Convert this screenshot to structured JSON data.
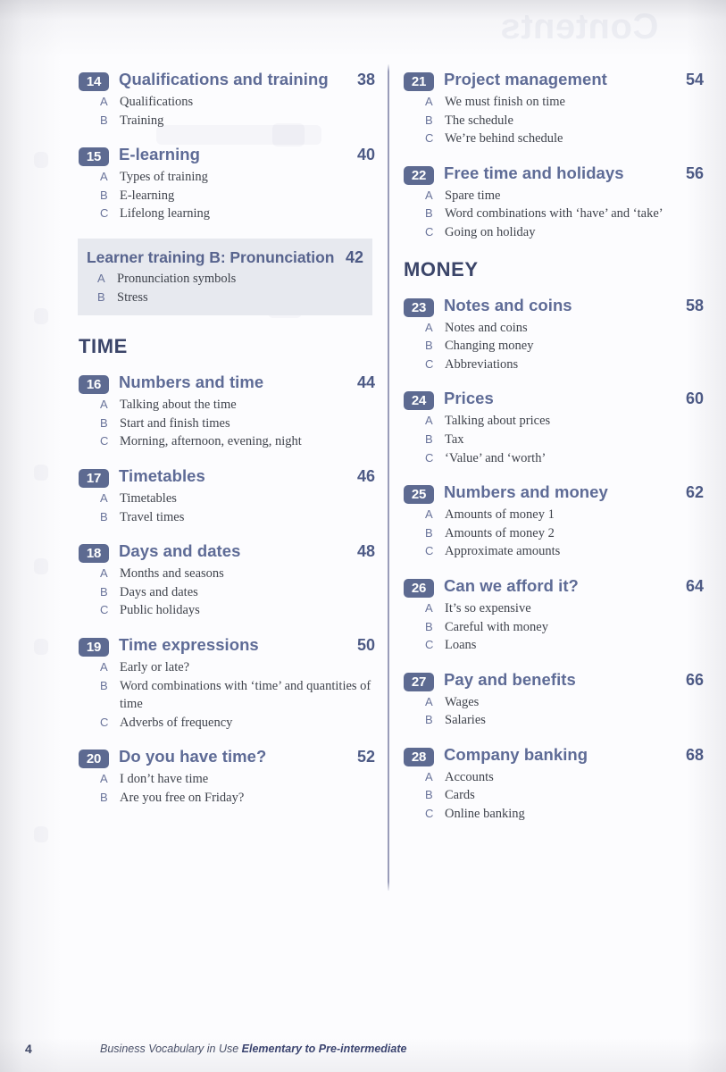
{
  "document": {
    "kind": "book-table-of-contents",
    "bleed_text": "Contents"
  },
  "footer": {
    "folio": "4",
    "running_head_normal": "Business Vocabulary in Use ",
    "running_head_bold": "Elementary to Pre-intermediate"
  },
  "colors": {
    "badge_fill": "#5d6a91",
    "unit_title": "#5e6b96",
    "page_number": "#4d5a85",
    "section_head": "#3b4569",
    "boxed_bg": "#e7e9ef",
    "sub_letter": "#69739a",
    "sub_text": "#3f434c"
  },
  "left_column": [
    {
      "type": "unit",
      "number": "14",
      "title": "Qualifications and training",
      "page": "38",
      "subs": [
        {
          "letter": "A",
          "text": "Qualifications"
        },
        {
          "letter": "B",
          "text": "Training"
        }
      ]
    },
    {
      "type": "unit",
      "number": "15",
      "title": "E-learning",
      "page": "40",
      "subs": [
        {
          "letter": "A",
          "text": "Types of training"
        },
        {
          "letter": "B",
          "text": "E-learning"
        },
        {
          "letter": "C",
          "text": "Lifelong learning"
        }
      ]
    },
    {
      "type": "boxed",
      "title": "Learner training B: Pronunciation",
      "page": "42",
      "subs": [
        {
          "letter": "A",
          "text": "Pronunciation symbols"
        },
        {
          "letter": "B",
          "text": "Stress"
        }
      ]
    },
    {
      "type": "section",
      "title": "TIME"
    },
    {
      "type": "unit",
      "number": "16",
      "title": "Numbers and time",
      "page": "44",
      "subs": [
        {
          "letter": "A",
          "text": "Talking about the time"
        },
        {
          "letter": "B",
          "text": "Start and finish times"
        },
        {
          "letter": "C",
          "text": "Morning, afternoon, evening, night"
        }
      ]
    },
    {
      "type": "unit",
      "number": "17",
      "title": "Timetables",
      "page": "46",
      "subs": [
        {
          "letter": "A",
          "text": "Timetables"
        },
        {
          "letter": "B",
          "text": "Travel times"
        }
      ]
    },
    {
      "type": "unit",
      "number": "18",
      "title": "Days and dates",
      "page": "48",
      "subs": [
        {
          "letter": "A",
          "text": "Months and seasons"
        },
        {
          "letter": "B",
          "text": "Days and dates"
        },
        {
          "letter": "C",
          "text": "Public holidays"
        }
      ]
    },
    {
      "type": "unit",
      "number": "19",
      "title": "Time expressions",
      "page": "50",
      "subs": [
        {
          "letter": "A",
          "text": "Early or late?"
        },
        {
          "letter": "B",
          "text": "Word combinations with ‘time’ and quantities of time"
        },
        {
          "letter": "C",
          "text": "Adverbs of frequency"
        }
      ]
    },
    {
      "type": "unit",
      "number": "20",
      "title": "Do you have time?",
      "page": "52",
      "subs": [
        {
          "letter": "A",
          "text": "I don’t have time"
        },
        {
          "letter": "B",
          "text": "Are you free on Friday?"
        }
      ]
    }
  ],
  "right_column": [
    {
      "type": "unit",
      "number": "21",
      "title": "Project management",
      "page": "54",
      "subs": [
        {
          "letter": "A",
          "text": "We must finish on time"
        },
        {
          "letter": "B",
          "text": "The schedule"
        },
        {
          "letter": "C",
          "text": "We’re behind schedule"
        }
      ]
    },
    {
      "type": "unit",
      "number": "22",
      "title": "Free time and holidays",
      "page": "56",
      "subs": [
        {
          "letter": "A",
          "text": "Spare time"
        },
        {
          "letter": "B",
          "text": "Word combinations with ‘have’ and ‘take’"
        },
        {
          "letter": "C",
          "text": "Going on holiday"
        }
      ]
    },
    {
      "type": "section",
      "title": "MONEY"
    },
    {
      "type": "unit",
      "number": "23",
      "title": "Notes and coins",
      "page": "58",
      "subs": [
        {
          "letter": "A",
          "text": "Notes and coins"
        },
        {
          "letter": "B",
          "text": "Changing money"
        },
        {
          "letter": "C",
          "text": "Abbreviations"
        }
      ]
    },
    {
      "type": "unit",
      "number": "24",
      "title": "Prices",
      "page": "60",
      "subs": [
        {
          "letter": "A",
          "text": "Talking about prices"
        },
        {
          "letter": "B",
          "text": "Tax"
        },
        {
          "letter": "C",
          "text": "‘Value’ and ‘worth’"
        }
      ]
    },
    {
      "type": "unit",
      "number": "25",
      "title": "Numbers and money",
      "page": "62",
      "subs": [
        {
          "letter": "A",
          "text": "Amounts of money 1"
        },
        {
          "letter": "B",
          "text": "Amounts of money 2"
        },
        {
          "letter": "C",
          "text": "Approximate amounts"
        }
      ]
    },
    {
      "type": "unit",
      "number": "26",
      "title": "Can we afford it?",
      "page": "64",
      "subs": [
        {
          "letter": "A",
          "text": "It’s so expensive"
        },
        {
          "letter": "B",
          "text": "Careful with money"
        },
        {
          "letter": "C",
          "text": "Loans"
        }
      ]
    },
    {
      "type": "unit",
      "number": "27",
      "title": "Pay and benefits",
      "page": "66",
      "subs": [
        {
          "letter": "A",
          "text": "Wages"
        },
        {
          "letter": "B",
          "text": "Salaries"
        }
      ]
    },
    {
      "type": "unit",
      "number": "28",
      "title": "Company banking",
      "page": "68",
      "subs": [
        {
          "letter": "A",
          "text": "Accounts"
        },
        {
          "letter": "B",
          "text": "Cards"
        },
        {
          "letter": "C",
          "text": "Online banking"
        }
      ]
    }
  ]
}
